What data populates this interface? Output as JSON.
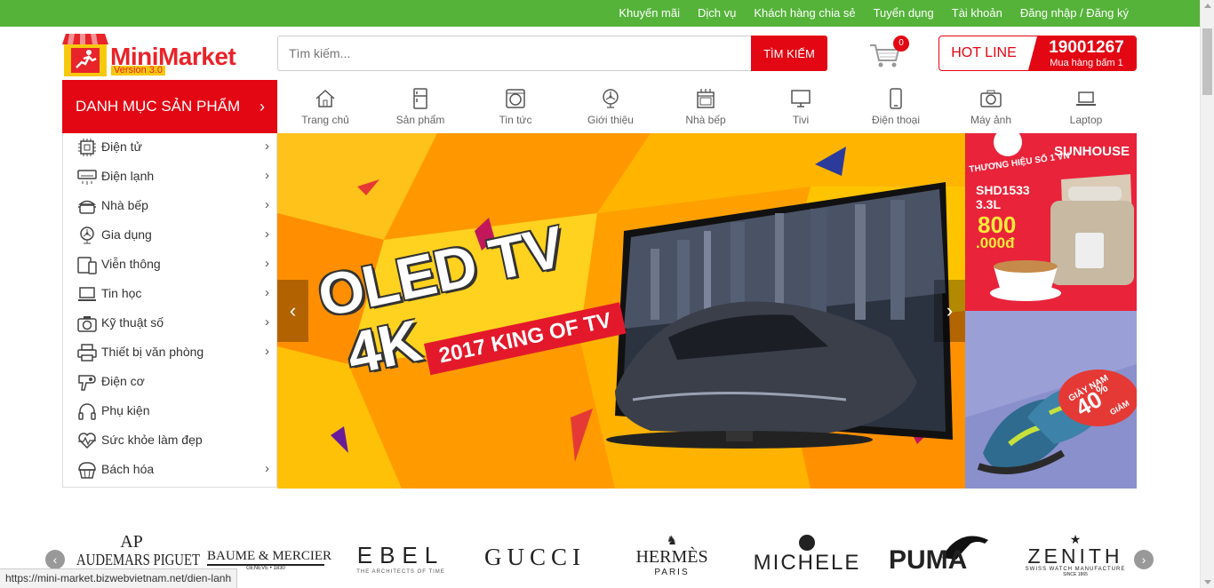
{
  "topbar": {
    "links": [
      "Khuyến mãi",
      "Dịch vụ",
      "Khách hàng chia sẻ",
      "Tuyển dụng",
      "Tài khoản",
      "Đăng nhập / Đăng ký"
    ]
  },
  "header": {
    "brand": "MiniMarket",
    "version": "Version 3.0",
    "search_placeholder": "Tìm kiếm...",
    "search_button": "TÌM KIẾM",
    "cart_count": "0",
    "hotline_label": "HOT LINE",
    "hotline_number": "19001267",
    "hotline_sub": "Mua hàng bấm 1"
  },
  "menu": {
    "title": "DANH MỤC SẢN PHẨM",
    "items": [
      {
        "label": "Điện tử",
        "icon": "chip-icon",
        "sub": true
      },
      {
        "label": "Điện lạnh",
        "icon": "air-conditioner-icon",
        "sub": true
      },
      {
        "label": "Nhà bếp",
        "icon": "pot-icon",
        "sub": true
      },
      {
        "label": "Gia dụng",
        "icon": "fan-icon",
        "sub": true
      },
      {
        "label": "Viễn thông",
        "icon": "phone-tablet-icon",
        "sub": true
      },
      {
        "label": "Tin học",
        "icon": "laptop-icon",
        "sub": true
      },
      {
        "label": "Kỹ thuật số",
        "icon": "camera-icon",
        "sub": true
      },
      {
        "label": "Thiết bị văn phòng",
        "icon": "printer-icon",
        "sub": true
      },
      {
        "label": "Điện cơ",
        "icon": "hair-dryer-icon",
        "sub": false
      },
      {
        "label": "Phụ kiện",
        "icon": "headphones-icon",
        "sub": false
      },
      {
        "label": "Sức khỏe làm đẹp",
        "icon": "heartbeat-icon",
        "sub": false
      },
      {
        "label": "Bách hóa",
        "icon": "cupcake-icon",
        "sub": true
      }
    ]
  },
  "nav": [
    {
      "label": "Trang chủ",
      "icon": "home-icon"
    },
    {
      "label": "Sản phẩm",
      "icon": "fridge-icon"
    },
    {
      "label": "Tin tức",
      "icon": "washing-machine-icon"
    },
    {
      "label": "Giới thiệu",
      "icon": "fan-icon"
    },
    {
      "label": "Nhà bếp",
      "icon": "stove-icon"
    },
    {
      "label": "Tivi",
      "icon": "tv-icon"
    },
    {
      "label": "Điện thoại",
      "icon": "smartphone-icon"
    },
    {
      "label": "Máy ảnh",
      "icon": "camera-icon"
    },
    {
      "label": "Laptop",
      "icon": "laptop-icon"
    }
  ],
  "banner": {
    "line1": "OLED TV",
    "line2": "4K",
    "tag": "2017 KING OF TV"
  },
  "side_ads": {
    "ad1_brand": "SUNHOUSE",
    "ad1_slogan": "THƯƠNG HIỆU SỐ 1 VN",
    "ad1_model": "SHD1533",
    "ad1_capacity": "3.3L",
    "ad1_price": "800",
    "ad1_price_unit": ".000đ",
    "ad2_label": "GIÀY NAM",
    "ad2_discount": "40",
    "ad2_discount_unit": "%",
    "ad2_discount_word": "GIẢM"
  },
  "brands": [
    "AUDEMARS PIGUET",
    "BAUME & MERCIER",
    "EBEL",
    "GUCCI",
    "HERMÈS",
    "MICHELE",
    "PUMA",
    "ZENITH"
  ],
  "brand_subs": {
    "baume": "GENEVE • 1830",
    "ebel": "THE ARCHITECTS OF TIME",
    "hermes": "PARIS",
    "zenith": "SWISS WATCH MANUFACTURE",
    "zenith_since": "SINCE 1865"
  },
  "statusbar": "https://mini-market.bizwebvietnam.net/dien-lanh"
}
